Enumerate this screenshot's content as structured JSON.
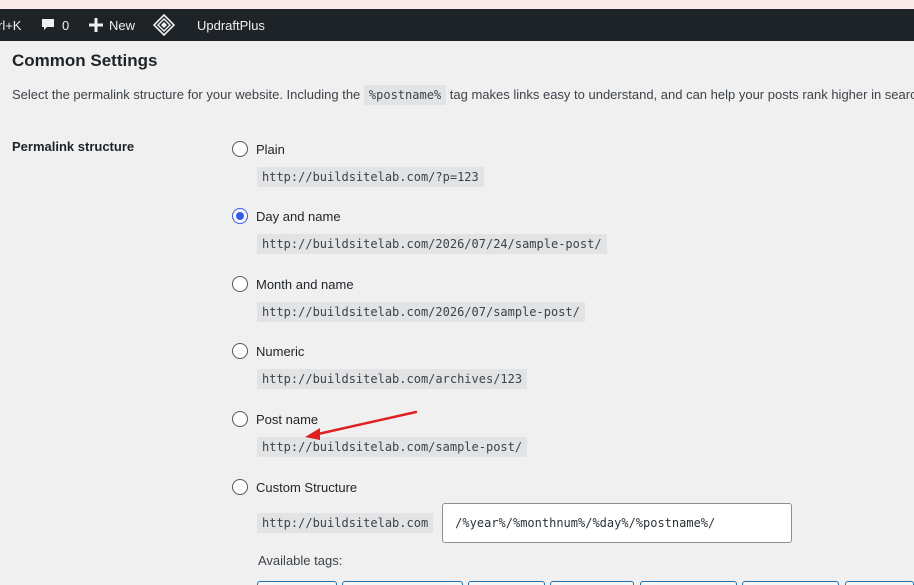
{
  "adminbar": {
    "shortcut_text": "rl+K",
    "comments_count": "0",
    "new_label": "New",
    "plugin_label": "UpdraftPlus"
  },
  "settings": {
    "section_title": "Common Settings",
    "intro_before": "Select the permalink structure for your website. Including the ",
    "intro_tag": "%postname%",
    "intro_after": " tag makes links easy to understand, and can help your posts rank higher in search",
    "row_label": "Permalink structure",
    "options": [
      {
        "label": "Plain",
        "example": "http://buildsitelab.com/?p=123",
        "checked": false
      },
      {
        "label": "Day and name",
        "example": "http://buildsitelab.com/2026/07/24/sample-post/",
        "checked": true
      },
      {
        "label": "Month and name",
        "example": "http://buildsitelab.com/2026/07/sample-post/",
        "checked": false
      },
      {
        "label": "Numeric",
        "example": "http://buildsitelab.com/archives/123",
        "checked": false
      },
      {
        "label": "Post name",
        "example": "http://buildsitelab.com/sample-post/",
        "checked": false
      },
      {
        "label": "Custom Structure",
        "example": "",
        "checked": false
      }
    ],
    "custom_base": "http://buildsitelab.com",
    "custom_value": "/%year%/%monthnum%/%day%/%postname%/",
    "available_tags_label": "Available tags:"
  },
  "colors": {
    "accent": "#3858e9",
    "admin_bar": "#1d2327",
    "annotation_arrow": "#e02020"
  }
}
